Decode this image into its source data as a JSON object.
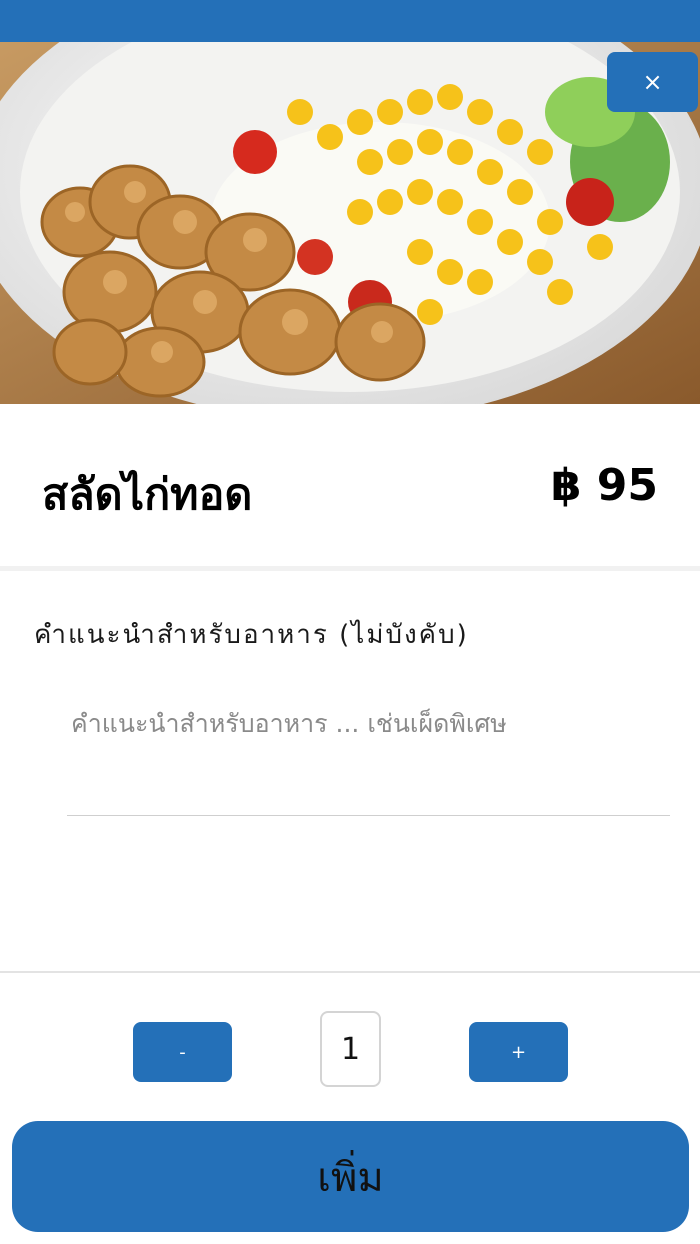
{
  "item": {
    "name": "สลัดไก่ทอด",
    "price": "฿ 95",
    "image_alt": "food-photo"
  },
  "actions": {
    "close_label": "×",
    "add_label": "เพิ่ม"
  },
  "notes": {
    "label": "คำแนะนำสำหรับอาหาร (ไม่บังคับ)",
    "placeholder": "คำแนะนำสำหรับอาหาร ... เช่นเผ็ดพิเศษ",
    "value": ""
  },
  "quantity": {
    "minus_label": "-",
    "value": "1",
    "plus_label": "+"
  },
  "colors": {
    "primary": "#2470b8",
    "background": "#ffffff"
  }
}
